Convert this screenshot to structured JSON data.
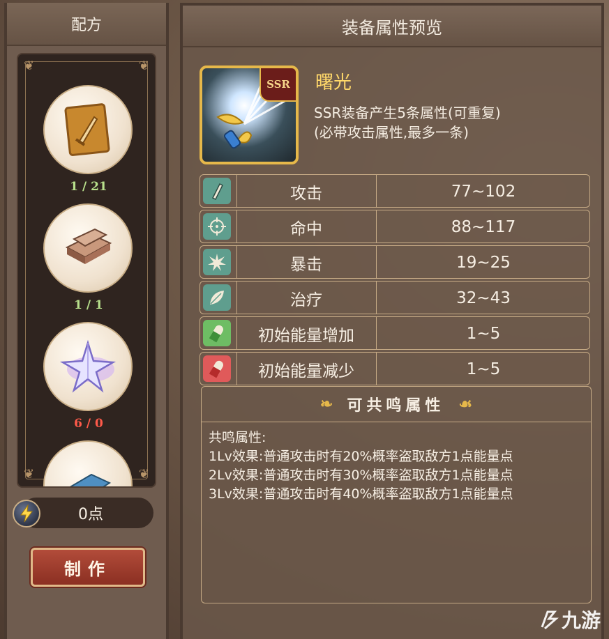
{
  "left": {
    "title": "配方",
    "recipes": [
      {
        "count": "1 / 21",
        "count_color": "#b8e08c",
        "icon": "sword-scroll-icon"
      },
      {
        "count": "1 / 1",
        "count_color": "#b8e08c",
        "icon": "metal-ingot-icon"
      },
      {
        "count": "6 / 0",
        "count_color": "#ff5a4a",
        "icon": "crystal-star-icon"
      },
      {
        "count": "",
        "count_color": "#b8e08c",
        "icon": "blue-material-icon"
      }
    ],
    "points": "0点",
    "make_button": "制作"
  },
  "right": {
    "title": "装备属性预览",
    "item": {
      "name": "曙光",
      "rarity": "SSR",
      "desc_line1": "SSR装备产生5条属性(可重复)",
      "desc_line2": "(必带攻击属性,最多一条)"
    },
    "stats": [
      {
        "name": "攻击",
        "value": "77~102",
        "icon": "attack-icon",
        "icon_bg": "#5f9e8e"
      },
      {
        "name": "命中",
        "value": "88~117",
        "icon": "crosshair-icon",
        "icon_bg": "#5f9e8e"
      },
      {
        "name": "暴击",
        "value": "19~25",
        "icon": "burst-icon",
        "icon_bg": "#5f9e8e"
      },
      {
        "name": "治疗",
        "value": "32~43",
        "icon": "leaf-icon",
        "icon_bg": "#5f9e8e"
      },
      {
        "name": "初始能量增加",
        "value": "1~5",
        "icon": "green-pill-icon",
        "icon_bg": "#6ebd64"
      },
      {
        "name": "初始能量减少",
        "value": "1~5",
        "icon": "red-pill-icon",
        "icon_bg": "#e05a5a"
      }
    ],
    "resonance": {
      "title": "可共鸣属性",
      "label": "共鸣属性:",
      "lines": [
        "1Lv效果:普通攻击时有20%概率盗取敌方1点能量点",
        "2Lv效果:普通攻击时有30%概率盗取敌方1点能量点",
        "3Lv效果:普通攻击时有40%概率盗取敌方1点能量点"
      ]
    }
  },
  "watermark": "九游"
}
